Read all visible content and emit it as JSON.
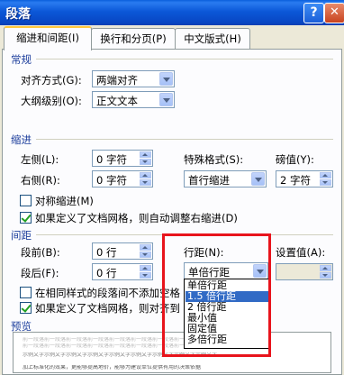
{
  "window": {
    "title": "段落"
  },
  "titlebar": {
    "help": "?",
    "close": "✕"
  },
  "tabs": [
    {
      "label": "缩进和间距(I)",
      "active": true
    },
    {
      "label": "换行和分页(P)",
      "active": false
    },
    {
      "label": "中文版式(H)",
      "active": false
    }
  ],
  "general": {
    "heading": "常规",
    "alignment_label": "对齐方式(G):",
    "alignment_value": "两端对齐",
    "outline_label": "大纲级别(O):",
    "outline_value": "正文文本"
  },
  "indent": {
    "heading": "缩进",
    "left_label": "左侧(L):",
    "left_value": "0 字符",
    "right_label": "右侧(R):",
    "right_value": "0 字符",
    "special_label": "特殊格式(S):",
    "special_value": "首行缩进",
    "by_label": "磅值(Y):",
    "by_value": "2 字符",
    "mirror_label": "对称缩进(M)",
    "mirror_checked": false,
    "auto_adjust_label": "如果定义了文档网格，则自动调整右缩进(D)",
    "auto_adjust_checked": true
  },
  "spacing": {
    "heading": "间距",
    "before_label": "段前(B):",
    "before_value": "0 行",
    "after_label": "段后(F):",
    "after_value": "0 行",
    "line_label": "行距(N):",
    "line_value": "单倍行距",
    "at_label": "设置值(A):",
    "no_space_label": "在相同样式的段落间不添加空格",
    "no_space_checked": false,
    "snap_grid_label": "如果定义了文档网格，则对齐到",
    "snap_grid_checked": true
  },
  "line_spacing_options": [
    "单倍行距",
    "1.5 倍行距",
    "2 倍行距",
    "最小值",
    "固定值",
    "多倍行距"
  ],
  "line_spacing_highlighted": "1.5 倍行距",
  "preview": {
    "heading": "预览",
    "lines": [
      "前一段落前一段落前一段落前一段落前一段落前一段落前一段落前一段落前一段落前一段落",
      "前一段落前一段落前一段落前一段落前一段落前一段落前一段落前一段落",
      "示例文字示例文字示例文字示例文字示例文字示例文字示例文字示例文字示例文字",
      "加上标准化的效果，更能够提高地价，能够为建设单位提供有用的决策依据"
    ]
  },
  "colors": {
    "highlight": "#316ac5",
    "annotation_box": "#e8141c",
    "section_heading": "#1d3e9c"
  }
}
